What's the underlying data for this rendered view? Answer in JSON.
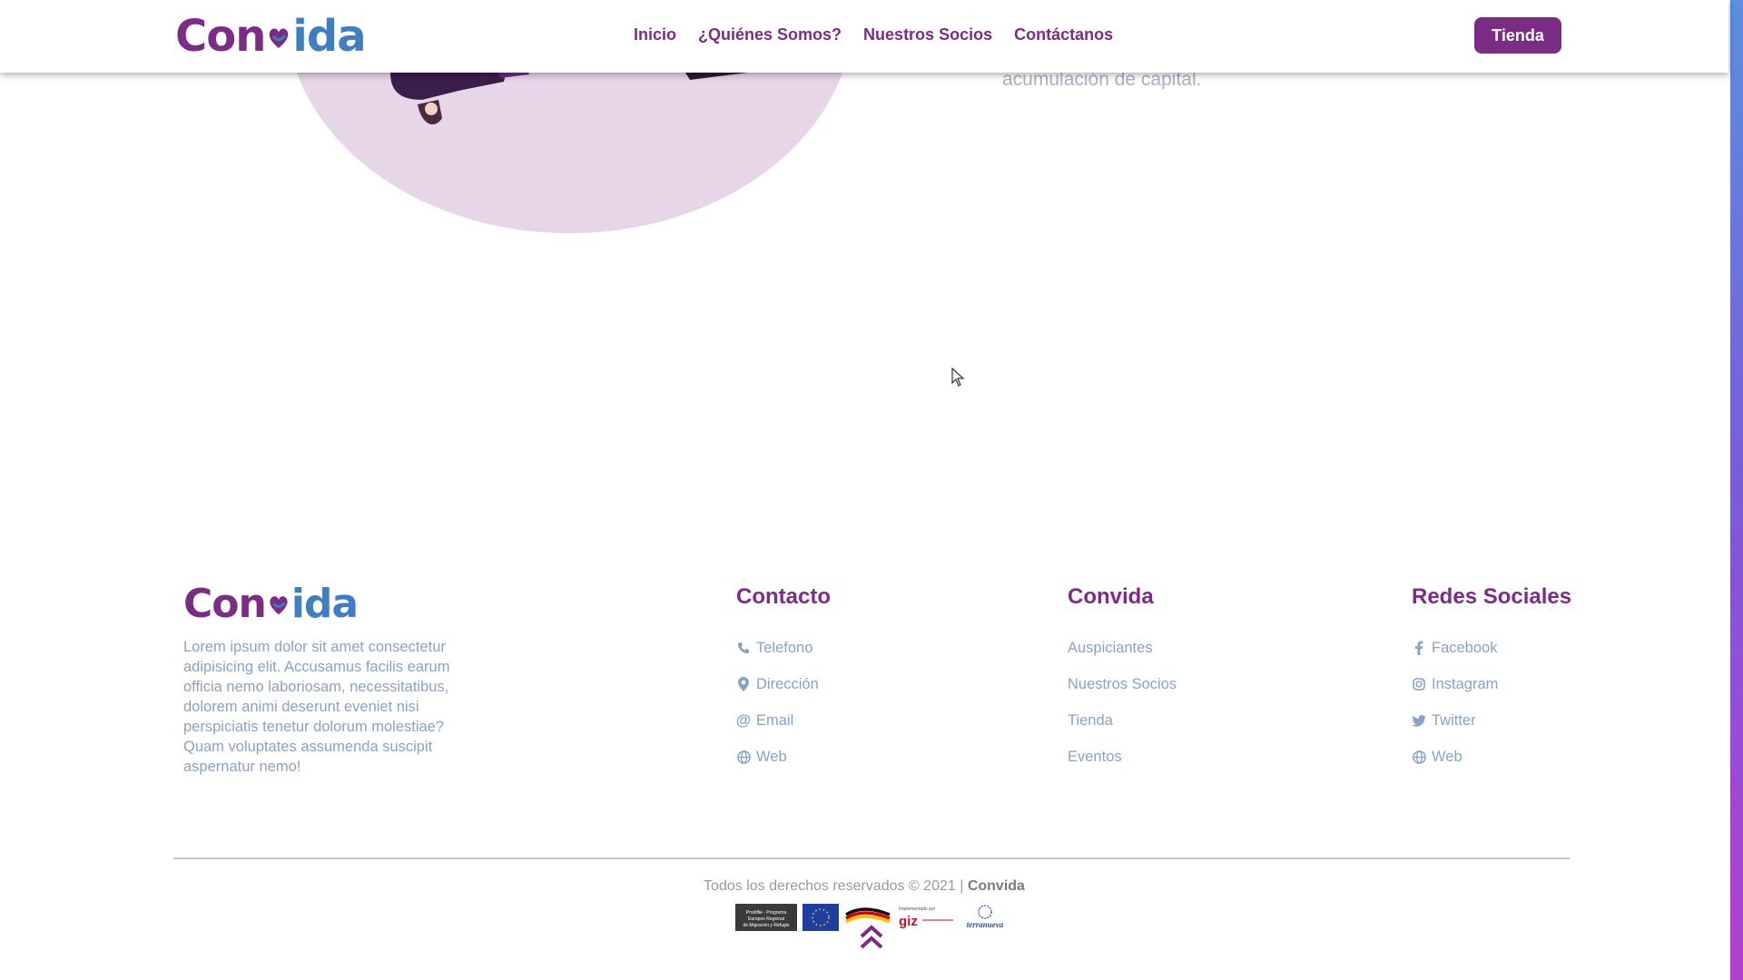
{
  "brand": {
    "logo_text": "Convida",
    "primary_color": "#7b2d86",
    "secondary_color": "#3f7fbf"
  },
  "header": {
    "nav": [
      {
        "label": "Inicio"
      },
      {
        "label": "¿Quiénes Somos?"
      },
      {
        "label": "Nuestros Socios"
      },
      {
        "label": "Contáctanos"
      }
    ],
    "cta_label": "Tienda"
  },
  "hero": {
    "text_fragment": "acumulación de capital."
  },
  "footer": {
    "description": "Lorem ipsum dolor sit amet consectetur adipisicing elit. Accusamus facilis earum officia nemo laboriosam, necessitatibus, dolorem animi deserunt eveniet nisi perspiciatis tenetur dolorum molestiae? Quam voluptates assumenda suscipit aspernatur nemo!",
    "contacto": {
      "title": "Contacto",
      "items": [
        {
          "label": "Telefono",
          "icon": "phone-icon"
        },
        {
          "label": "Dirección",
          "icon": "map-pin-icon"
        },
        {
          "label": "Email",
          "icon": "at-icon"
        },
        {
          "label": "Web",
          "icon": "globe-icon"
        }
      ]
    },
    "convida": {
      "title": "Convida",
      "items": [
        {
          "label": "Auspiciantes"
        },
        {
          "label": "Nuestros Socios"
        },
        {
          "label": "Tienda"
        },
        {
          "label": "Eventos"
        }
      ]
    },
    "redes": {
      "title": "Redes Sociales",
      "items": [
        {
          "label": "Facebook",
          "icon": "facebook-icon"
        },
        {
          "label": "Instagram",
          "icon": "instagram-icon"
        },
        {
          "label": "Twitter",
          "icon": "twitter-icon"
        },
        {
          "label": "Web",
          "icon": "globe-icon"
        }
      ]
    },
    "copyright_prefix": "Todos los derechos reservados © 2021 |",
    "copyright_brand": "Convida",
    "sponsors": {
      "prodible": "Prodiflie - Programa Europeo Regional de Migración y Refugio",
      "giz_caption": "Implementado por",
      "giz": "giz",
      "terranueva": "terranueva"
    }
  }
}
